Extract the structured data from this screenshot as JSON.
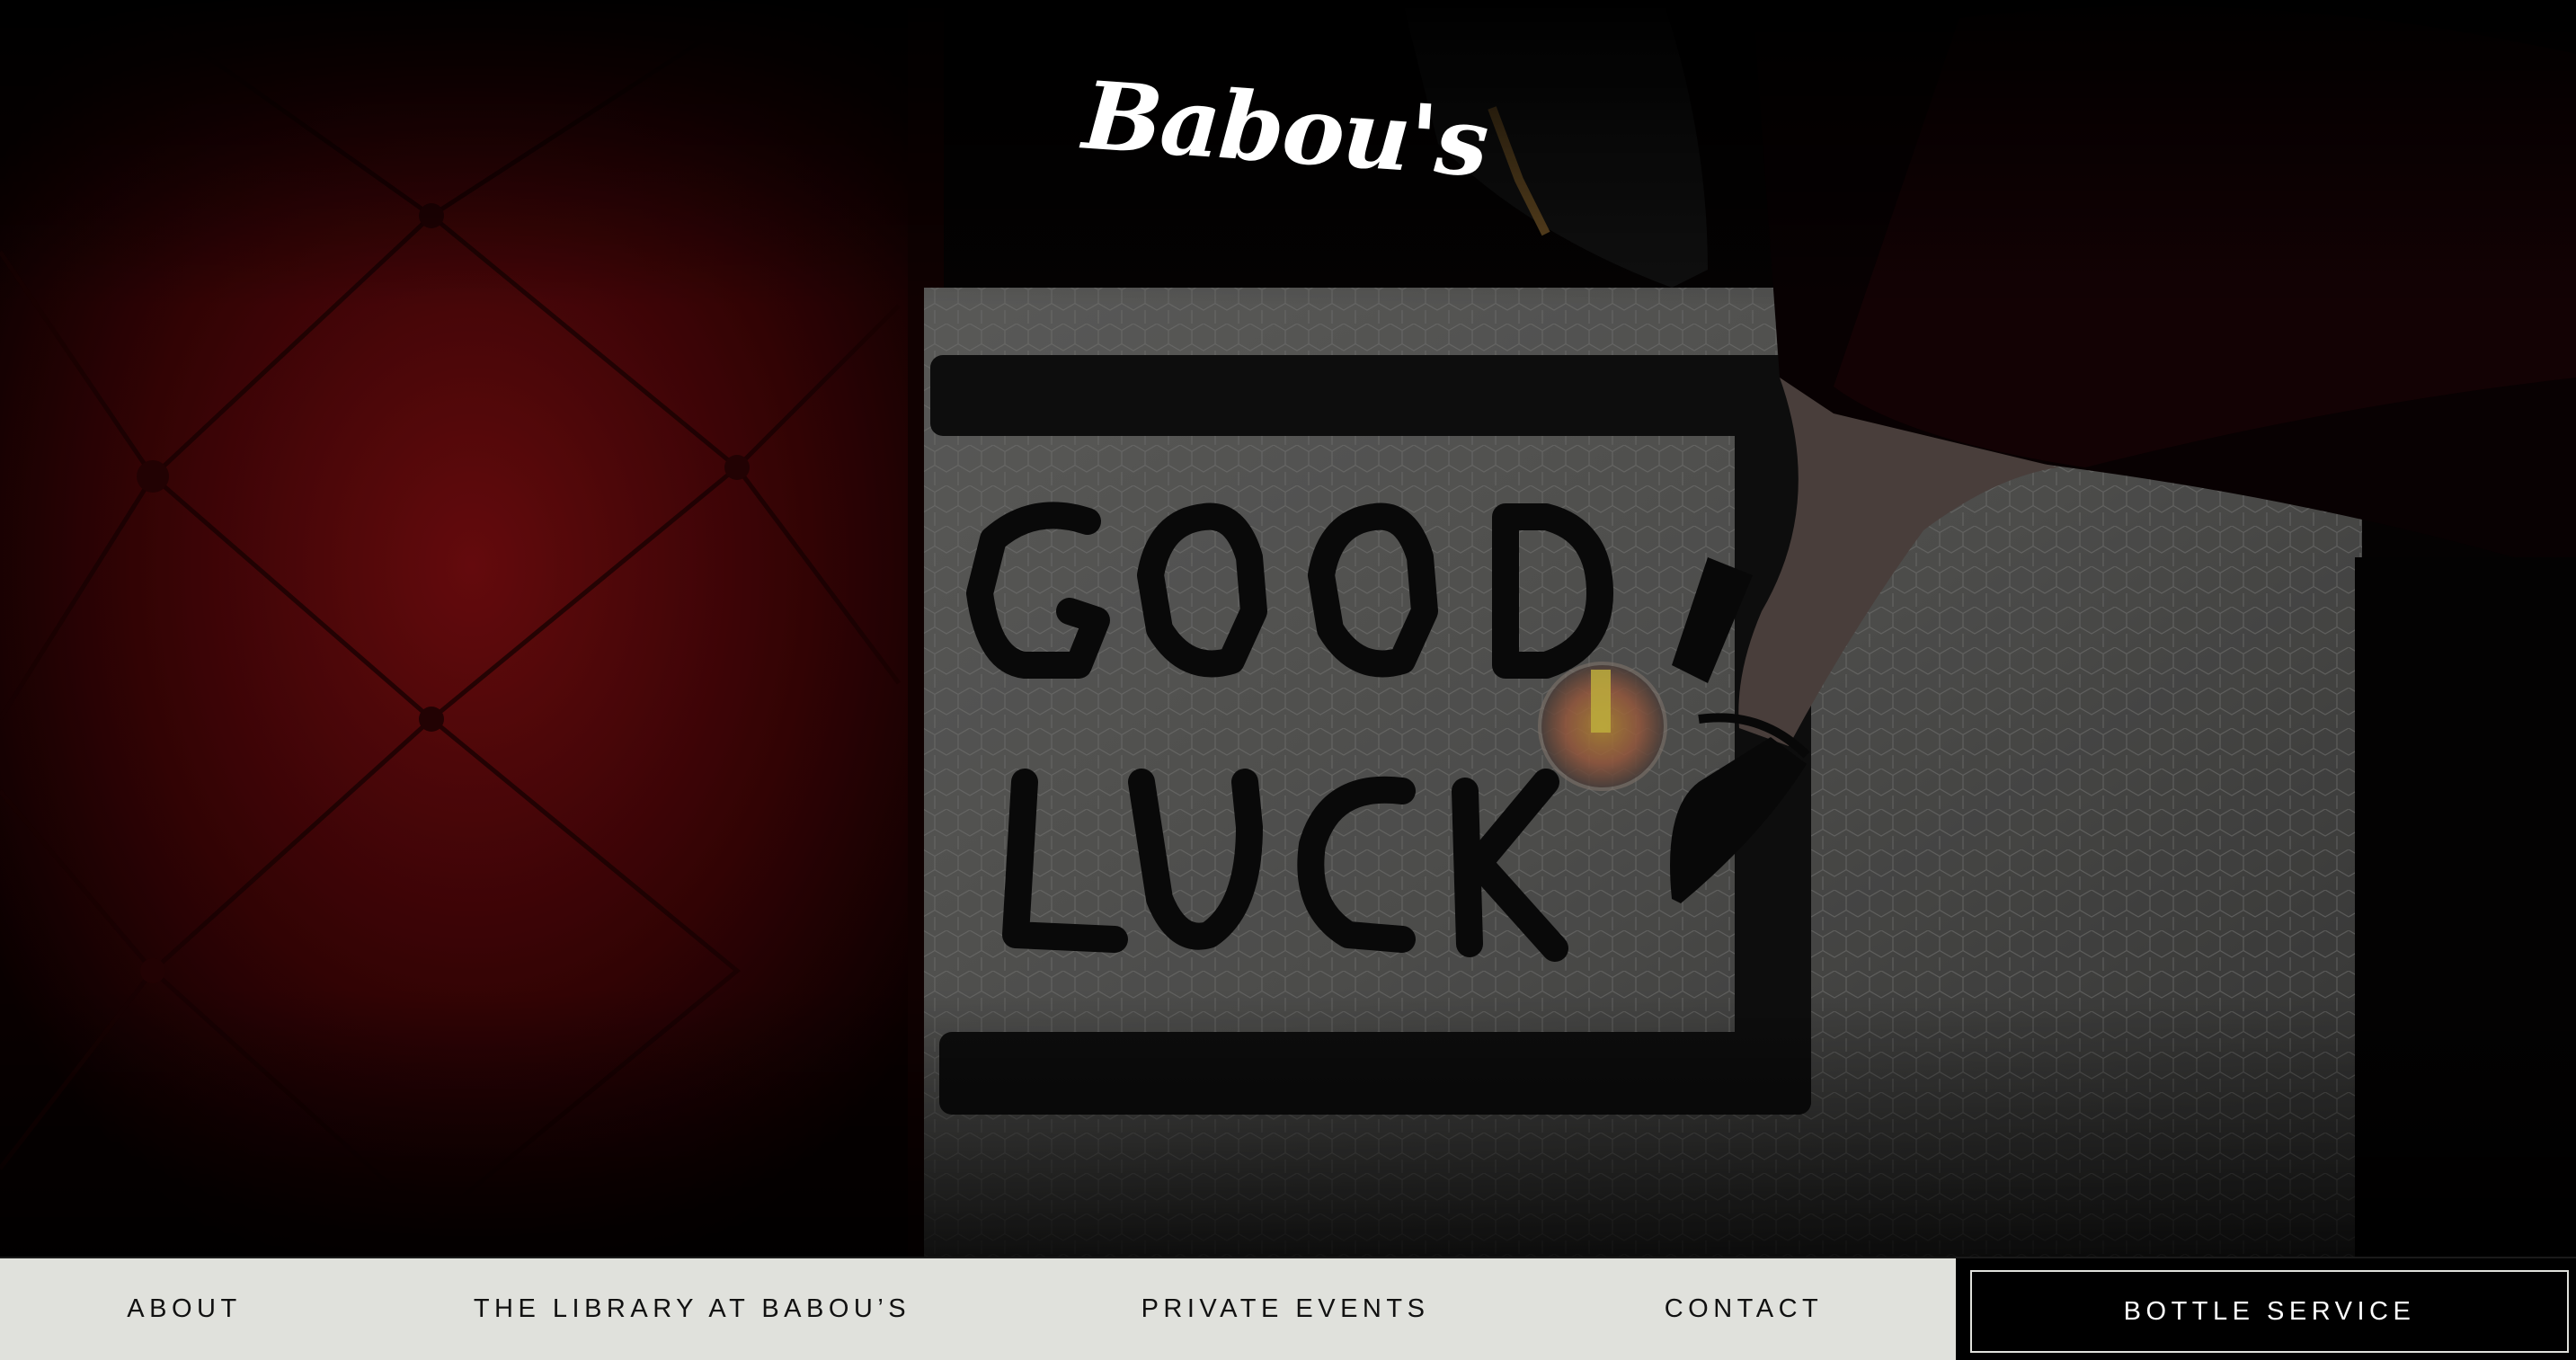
{
  "brand": {
    "logo_text": "Babou's"
  },
  "hero": {
    "mosaic_text_line1": "GOOD",
    "mosaic_text_line2": "LUCK"
  },
  "nav": {
    "about": "ABOUT",
    "library": "THE LIBRARY AT BABOU’S",
    "private_events": "PRIVATE EVENTS",
    "contact": "CONTACT",
    "bottle_service": "BOTTLE SERVICE"
  },
  "colors": {
    "nav_background": "#e0e1dc",
    "nav_text": "#111111",
    "cta_background": "#000000",
    "cta_text": "#ffffff",
    "banquette_red": "#6a0a0c"
  }
}
